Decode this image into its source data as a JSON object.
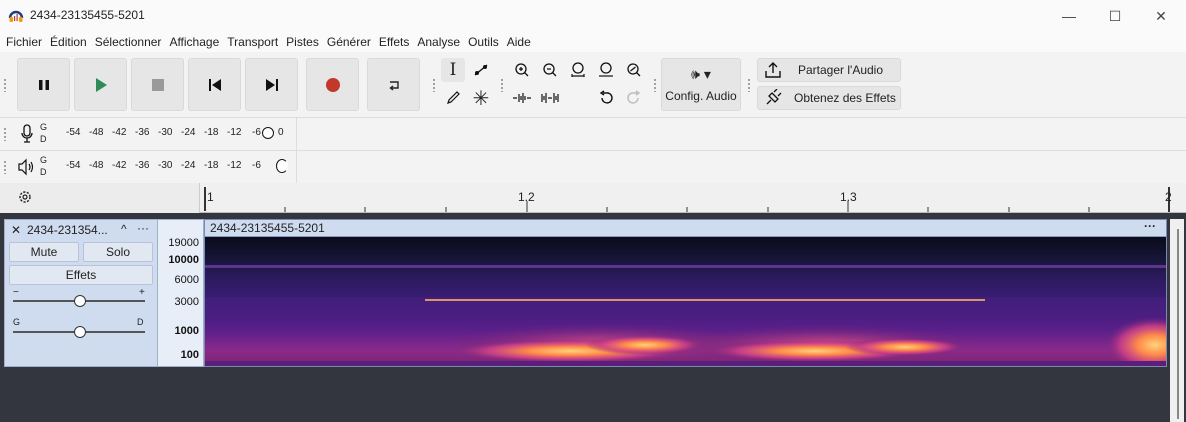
{
  "window": {
    "title": "2434-23135455-5201",
    "minimize": "—",
    "maximize": "☐",
    "close": "✕"
  },
  "menu": [
    "Fichier",
    "Édition",
    "Sélectionner",
    "Affichage",
    "Transport",
    "Pistes",
    "Générer",
    "Effets",
    "Analyse",
    "Outils",
    "Aide"
  ],
  "toolbar": {
    "audio_setup_label": "Config. Audio",
    "share_label": "Partager l'Audio",
    "get_effects_label": "Obtenez des Effets"
  },
  "meters": {
    "ticks": [
      "-54",
      "-48",
      "-42",
      "-36",
      "-30",
      "-24",
      "-18",
      "-12",
      "-6",
      "0"
    ],
    "playback_ticks": [
      "-54",
      "-48",
      "-42",
      "-36",
      "-30",
      "-24",
      "-18",
      "-12",
      "-6"
    ],
    "channel_left": "G",
    "channel_right": "D"
  },
  "ruler": {
    "labels": [
      "1",
      "1.2",
      "1.3",
      "2"
    ]
  },
  "track": {
    "name": "2434-231354...",
    "collapse": "^",
    "menu": "···",
    "mute_label": "Mute",
    "solo_label": "Solo",
    "effects_label": "Effets",
    "gain_minus": "−",
    "gain_plus": "+",
    "pan_left": "G",
    "pan_right": "D"
  },
  "clip": {
    "name": "2434-23135455-5201",
    "menu": "···"
  },
  "frequency_scale": [
    "19000",
    "10000",
    "6000",
    "3000",
    "1000",
    "100"
  ],
  "colors": {
    "accent": "#3c78d8",
    "record": "#c0392b",
    "play": "#2e8b57",
    "spectrogram_high": "#ffb347"
  }
}
